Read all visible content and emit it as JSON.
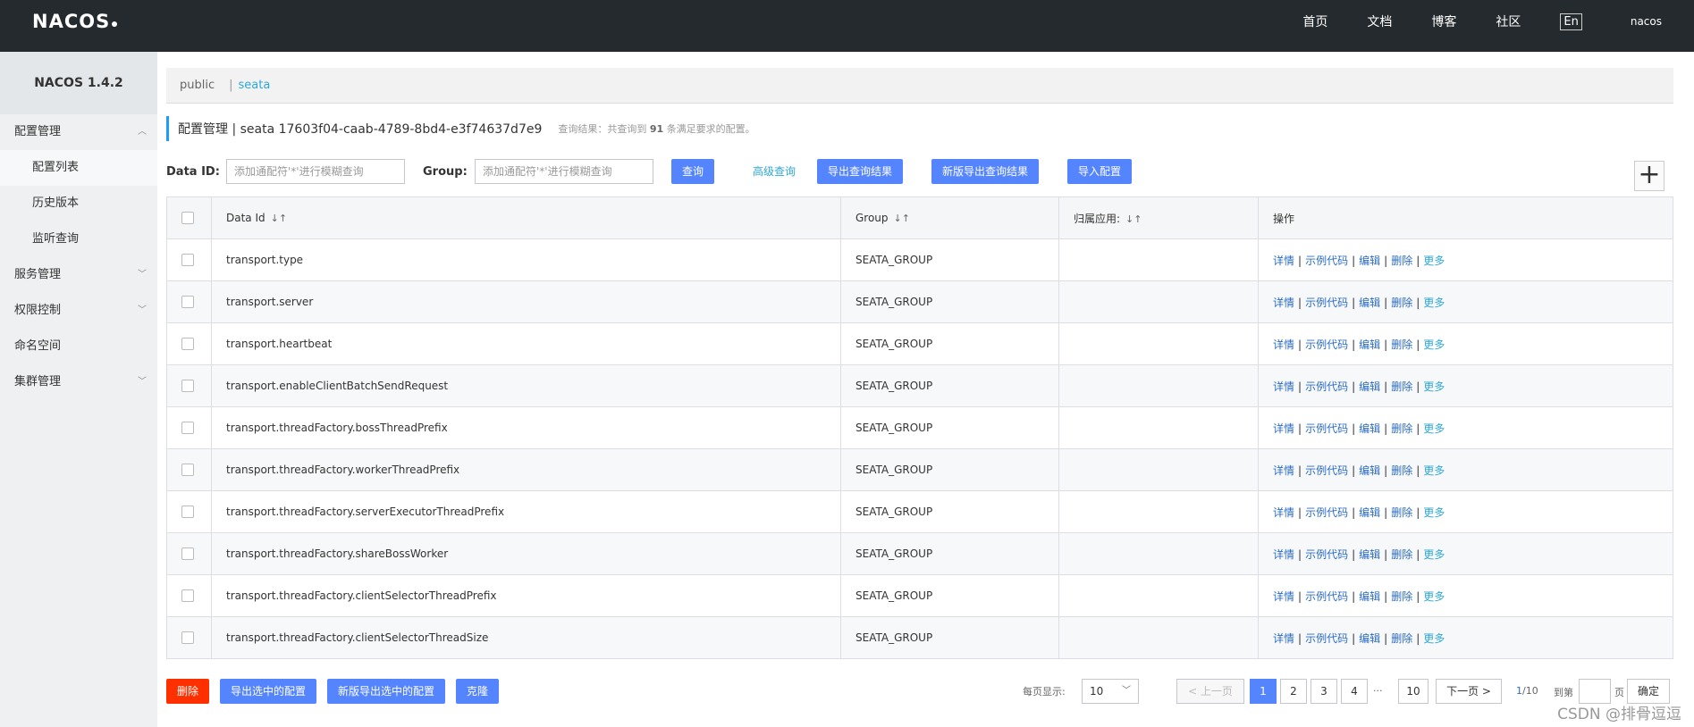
{
  "header": {
    "logo": "NACOS",
    "nav": [
      "首页",
      "文档",
      "博客",
      "社区"
    ],
    "lang": "En",
    "user": "nacos"
  },
  "sidebar": {
    "version": "NACOS 1.4.2",
    "items": [
      {
        "label": "配置管理",
        "expanded": true
      },
      {
        "label": "配置列表"
      },
      {
        "label": "历史版本"
      },
      {
        "label": "监听查询"
      },
      {
        "label": "服务管理"
      },
      {
        "label": "权限控制"
      },
      {
        "label": "命名空间"
      },
      {
        "label": "集群管理"
      }
    ]
  },
  "namespaces": {
    "items": [
      "public",
      "seata"
    ],
    "separator": "|",
    "active": "seata"
  },
  "title": {
    "text": "配置管理 | seata  17603f04-caab-4789-8bd4-e3f74637d7e9",
    "result_prefix": "查询结果：共查询到",
    "result_count": "91",
    "result_suffix": "条满足要求的配置。"
  },
  "search": {
    "data_id_label": "Data ID:",
    "data_id_placeholder": "添加通配符'*'进行模糊查询",
    "group_label": "Group:",
    "group_placeholder": "添加通配符'*'进行模糊查询",
    "query_button": "查询",
    "advanced_link": "高级查询",
    "export_button": "导出查询结果",
    "export_new_button": "新版导出查询结果",
    "import_button": "导入配置",
    "plus": "+"
  },
  "table": {
    "columns": [
      "Data Id",
      "Group",
      "归属应用:",
      "操作"
    ],
    "ops": [
      "详情",
      "示例代码",
      "编辑",
      "删除",
      "更多"
    ],
    "rows": [
      {
        "data_id": "transport.type",
        "group": "SEATA_GROUP",
        "app": ""
      },
      {
        "data_id": "transport.server",
        "group": "SEATA_GROUP",
        "app": ""
      },
      {
        "data_id": "transport.heartbeat",
        "group": "SEATA_GROUP",
        "app": ""
      },
      {
        "data_id": "transport.enableClientBatchSendRequest",
        "group": "SEATA_GROUP",
        "app": ""
      },
      {
        "data_id": "transport.threadFactory.bossThreadPrefix",
        "group": "SEATA_GROUP",
        "app": ""
      },
      {
        "data_id": "transport.threadFactory.workerThreadPrefix",
        "group": "SEATA_GROUP",
        "app": ""
      },
      {
        "data_id": "transport.threadFactory.serverExecutorThreadPrefix",
        "group": "SEATA_GROUP",
        "app": ""
      },
      {
        "data_id": "transport.threadFactory.shareBossWorker",
        "group": "SEATA_GROUP",
        "app": ""
      },
      {
        "data_id": "transport.threadFactory.clientSelectorThreadPrefix",
        "group": "SEATA_GROUP",
        "app": ""
      },
      {
        "data_id": "transport.threadFactory.clientSelectorThreadSize",
        "group": "SEATA_GROUP",
        "app": ""
      }
    ]
  },
  "footer": {
    "delete_button": "删除",
    "export_selected": "导出选中的配置",
    "export_selected_new": "新版导出选中的配置",
    "clone_button": "克隆",
    "page_size_label": "每页显示:",
    "page_size": "10",
    "prev": "< 上一页",
    "next": "下一页 >",
    "pages": [
      "1",
      "2",
      "3",
      "4"
    ],
    "ellipsis": "···",
    "last_page": "10",
    "current_page": "1",
    "total_pages": "/10",
    "goto_label": "到第",
    "page_unit": "页",
    "confirm": "确定"
  },
  "watermark": "CSDN @排骨逗逗"
}
